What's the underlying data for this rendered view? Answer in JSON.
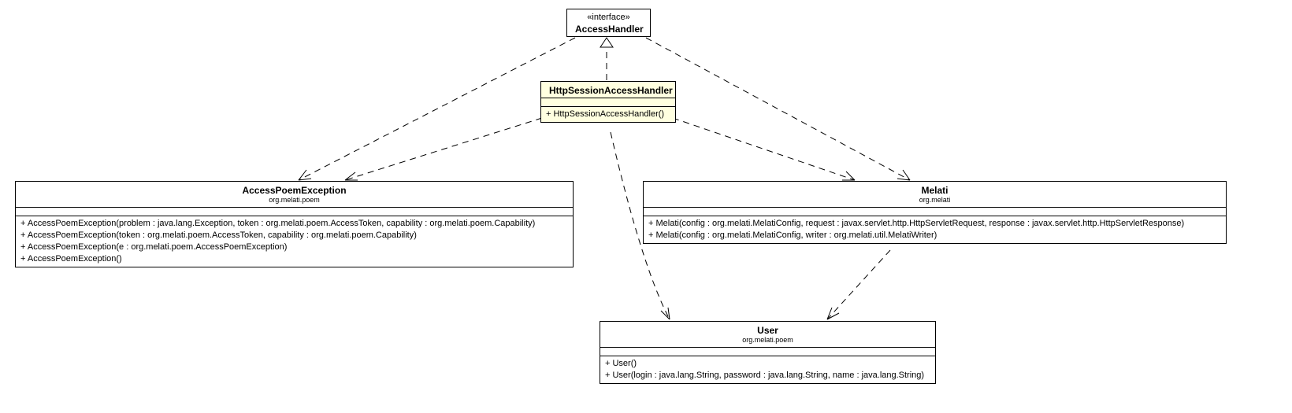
{
  "chart_data": {
    "type": "uml-class-diagram",
    "classes": [
      {
        "id": "AccessHandler",
        "stereotype": "«interface»",
        "name": "AccessHandler"
      },
      {
        "id": "HttpSessionAccessHandler",
        "name": "HttpSessionAccessHandler",
        "ops": [
          "+ HttpSessionAccessHandler()"
        ],
        "highlight": true
      },
      {
        "id": "AccessPoemException",
        "name": "AccessPoemException",
        "pkg": "org.melati.poem",
        "ops": [
          "+ AccessPoemException(problem : java.lang.Exception, token : org.melati.poem.AccessToken, capability : org.melati.poem.Capability)",
          "+ AccessPoemException(token : org.melati.poem.AccessToken, capability : org.melati.poem.Capability)",
          "+ AccessPoemException(e : org.melati.poem.AccessPoemException)",
          "+ AccessPoemException()"
        ]
      },
      {
        "id": "Melati",
        "name": "Melati",
        "pkg": "org.melati",
        "ops": [
          "+ Melati(config : org.melati.MelatiConfig, request : javax.servlet.http.HttpServletRequest, response : javax.servlet.http.HttpServletResponse)",
          "+ Melati(config : org.melati.MelatiConfig, writer : org.melati.util.MelatiWriter)"
        ]
      },
      {
        "id": "User",
        "name": "User",
        "pkg": "org.melati.poem",
        "ops": [
          "+ User()",
          "+ User(login : java.lang.String, password : java.lang.String, name : java.lang.String)"
        ]
      }
    ],
    "relationships": [
      {
        "from": "HttpSessionAccessHandler",
        "to": "AccessHandler",
        "type": "realization"
      },
      {
        "from": "HttpSessionAccessHandler",
        "to": "AccessPoemException",
        "type": "dependency"
      },
      {
        "from": "AccessHandler",
        "to": "AccessPoemException",
        "type": "dependency"
      },
      {
        "from": "HttpSessionAccessHandler",
        "to": "Melati",
        "type": "dependency"
      },
      {
        "from": "AccessHandler",
        "to": "Melati",
        "type": "dependency"
      },
      {
        "from": "HttpSessionAccessHandler",
        "to": "User",
        "type": "dependency"
      },
      {
        "from": "Melati",
        "to": "User",
        "type": "dependency"
      }
    ]
  },
  "interface_stereo": "«interface»",
  "access_handler": {
    "name": "AccessHandler"
  },
  "http_handler": {
    "name": "HttpSessionAccessHandler",
    "op0": "+ HttpSessionAccessHandler()"
  },
  "ape": {
    "name": "AccessPoemException",
    "pkg": "org.melati.poem",
    "op0": "+ AccessPoemException(problem : java.lang.Exception, token : org.melati.poem.AccessToken, capability : org.melati.poem.Capability)",
    "op1": "+ AccessPoemException(token : org.melati.poem.AccessToken, capability : org.melati.poem.Capability)",
    "op2": "+ AccessPoemException(e : org.melati.poem.AccessPoemException)",
    "op3": "+ AccessPoemException()"
  },
  "melati": {
    "name": "Melati",
    "pkg": "org.melati",
    "op0": "+ Melati(config : org.melati.MelatiConfig, request : javax.servlet.http.HttpServletRequest, response : javax.servlet.http.HttpServletResponse)",
    "op1": "+ Melati(config : org.melati.MelatiConfig, writer : org.melati.util.MelatiWriter)"
  },
  "user": {
    "name": "User",
    "pkg": "org.melati.poem",
    "op0": "+ User()",
    "op1": "+ User(login : java.lang.String, password : java.lang.String, name : java.lang.String)"
  }
}
